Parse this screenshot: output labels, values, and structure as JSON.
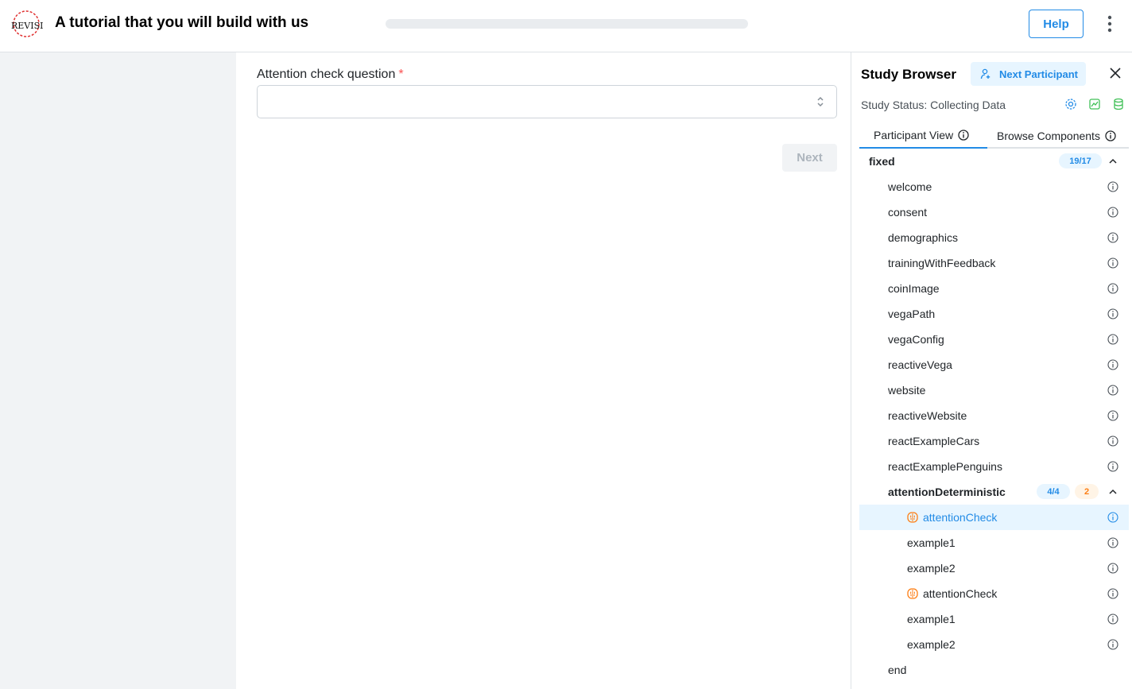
{
  "header": {
    "logo_text": "REVISIT",
    "title": "A tutorial that you will build with us",
    "progress": 0,
    "help_label": "Help"
  },
  "main": {
    "question_label": "Attention check question",
    "required_marker": "*",
    "select_value": "",
    "next_label": "Next"
  },
  "panel": {
    "title": "Study Browser",
    "next_participant_label": "Next Participant",
    "status": "Study Status: Collecting Data",
    "tabs": [
      {
        "label": "Participant View",
        "active": true
      },
      {
        "label": "Browse Components",
        "active": false
      }
    ],
    "tree": [
      {
        "label": "fixed",
        "level": 0,
        "group": true,
        "badge1": "19/17"
      },
      {
        "label": "welcome",
        "level": 1
      },
      {
        "label": "consent",
        "level": 1
      },
      {
        "label": "demographics",
        "level": 1
      },
      {
        "label": "trainingWithFeedback",
        "level": 1
      },
      {
        "label": "coinImage",
        "level": 1
      },
      {
        "label": "vegaPath",
        "level": 1
      },
      {
        "label": "vegaConfig",
        "level": 1
      },
      {
        "label": "reactiveVega",
        "level": 1
      },
      {
        "label": "website",
        "level": 1
      },
      {
        "label": "reactiveWebsite",
        "level": 1
      },
      {
        "label": "reactExampleCars",
        "level": 1
      },
      {
        "label": "reactExamplePenguins",
        "level": 1
      },
      {
        "label": "attentionDeterministic",
        "level": 1,
        "group": true,
        "badge1": "4/4",
        "badge2": "2"
      },
      {
        "label": "attentionCheck",
        "level": 2,
        "brain": true,
        "selected": true
      },
      {
        "label": "example1",
        "level": 2
      },
      {
        "label": "example2",
        "level": 2
      },
      {
        "label": "attentionCheck",
        "level": 2,
        "brain": true
      },
      {
        "label": "example1",
        "level": 2
      },
      {
        "label": "example2",
        "level": 2
      },
      {
        "label": "end",
        "level": 1,
        "noinfo": true
      }
    ]
  },
  "colors": {
    "accent": "#228be6",
    "orange": "#fd7e14",
    "green": "#40c057",
    "required": "#fa5252"
  }
}
